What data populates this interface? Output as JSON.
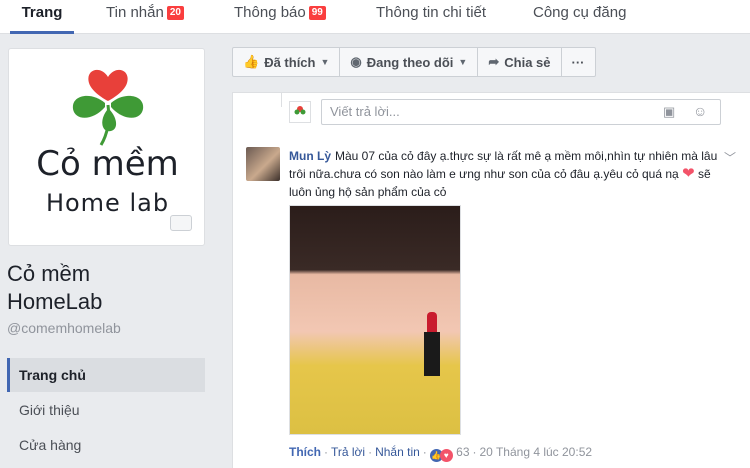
{
  "topnav": {
    "tabs": [
      {
        "label": "Trang",
        "badge": null
      },
      {
        "label": "Tin nhắn",
        "badge": "20"
      },
      {
        "label": "Thông báo",
        "badge": "99"
      },
      {
        "label": "Thông tin chi tiết",
        "badge": null
      },
      {
        "label": "Công cụ đăng",
        "badge": null
      }
    ]
  },
  "sidebar": {
    "logo_line1": "Cỏ mềm",
    "logo_line2": "Home lab",
    "page_name_line1": "Cỏ mềm",
    "page_name_line2": "HomeLab",
    "handle": "@comemhomelab",
    "nav": [
      "Trang chủ",
      "Giới thiệu",
      "Cửa hàng"
    ]
  },
  "actions": {
    "liked": "Đã thích",
    "following": "Đang theo dõi",
    "share": "Chia sẻ",
    "more": "···"
  },
  "reply": {
    "placeholder": "Viết trả lời..."
  },
  "comment": {
    "author": "Mun Lỳ",
    "text_part1": "Màu 07 của cỏ đây ạ.thực sự là rất mê ạ mềm môi,nhìn tự nhiên mà lâu trôi nữa.chưa có son nào làm e ưng như son của cỏ đâu ạ.yêu cỏ quá nạ",
    "text_part2": "sẽ luôn ủng hộ sản phẩm của cỏ",
    "like_label": "Thích",
    "reply_label": "Trả lời",
    "message_label": "Nhắn tin",
    "reaction_count": "63",
    "timestamp": "20 Tháng 4 lúc 20:52"
  },
  "colors": {
    "accent": "#4267b2",
    "badge": "#fa3e3e",
    "link": "#365899",
    "logo_red": "#e8403a",
    "logo_green": "#3f9a36"
  }
}
